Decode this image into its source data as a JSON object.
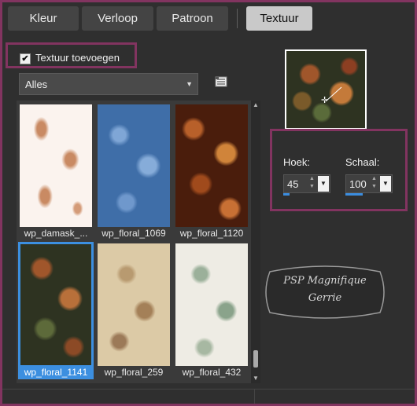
{
  "tabs": [
    {
      "label": "Kleur",
      "active": false
    },
    {
      "label": "Verloop",
      "active": false
    },
    {
      "label": "Patroon",
      "active": false
    },
    {
      "label": "Textuur",
      "active": true
    }
  ],
  "texture_toggle": {
    "label": "Textuur toevoegen",
    "checked": true
  },
  "category_dropdown": {
    "value": "Alles"
  },
  "textures": [
    {
      "name": "wp_damask_...",
      "selected": false
    },
    {
      "name": "wp_floral_1069",
      "selected": false
    },
    {
      "name": "wp_floral_1120",
      "selected": false
    },
    {
      "name": "wp_floral_1141",
      "selected": true
    },
    {
      "name": "wp_floral_259",
      "selected": false
    },
    {
      "name": "wp_floral_432",
      "selected": false
    }
  ],
  "angle": {
    "label": "Hoek:",
    "value": "45"
  },
  "scale": {
    "label": "Schaal:",
    "value": "100"
  },
  "watermark": {
    "line1": "PSP Magnifique",
    "line2": "Gerrie"
  },
  "colors": {
    "highlight": "#823460",
    "selection": "#3c8fe0",
    "panel": "#2f2f2f"
  }
}
